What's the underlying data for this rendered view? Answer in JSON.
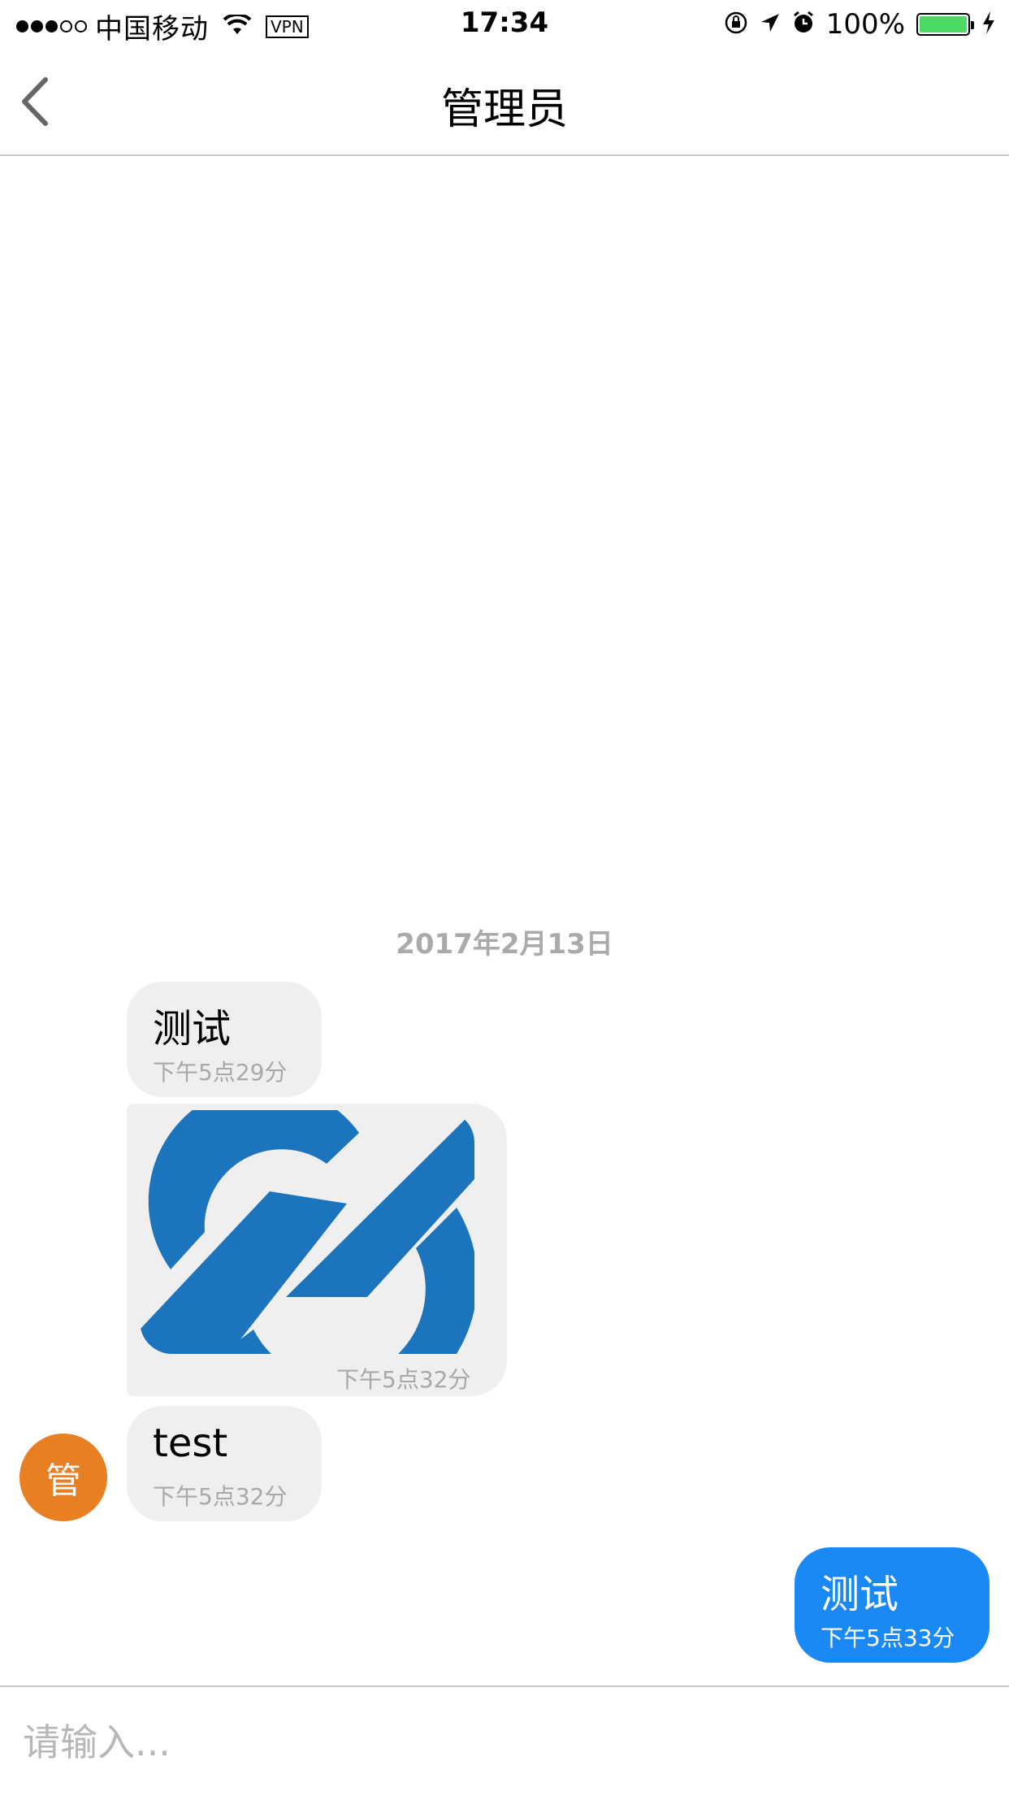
{
  "status_bar": {
    "carrier": "中国移动",
    "vpn": "VPN",
    "time": "17:34",
    "battery": "100%",
    "battery_level": 1.0,
    "battery_color": "#4cd964"
  },
  "nav": {
    "title": "管理员",
    "back_icon": "chevron-left-icon"
  },
  "chat": {
    "date_divider": "2017年2月13日",
    "messages": [
      {
        "direction": "in",
        "type": "text",
        "text": "测试",
        "time": "下午5点29分"
      },
      {
        "direction": "in",
        "type": "image",
        "image_icon": "chain-link-logo",
        "time": "下午5点32分"
      },
      {
        "direction": "in",
        "type": "text",
        "text": "test",
        "time": "下午5点32分"
      },
      {
        "direction": "out",
        "type": "text",
        "text": "测试",
        "time": "下午5点33分"
      }
    ],
    "avatar_label": "管",
    "avatar_color": "#e87f22",
    "outgoing_color": "#1a88f5",
    "incoming_color": "#efefef"
  },
  "input": {
    "placeholder": "请输入..."
  }
}
